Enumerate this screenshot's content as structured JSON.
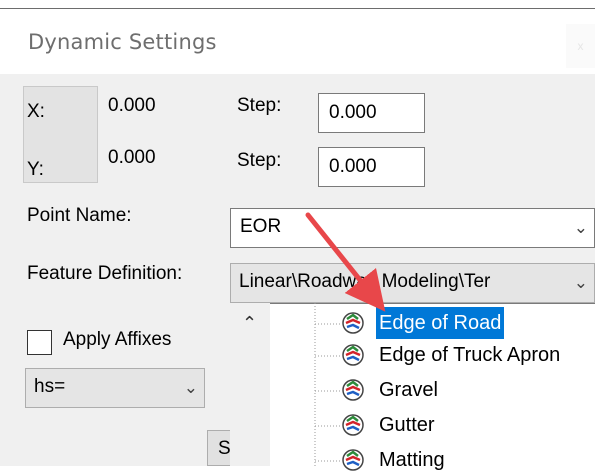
{
  "window": {
    "title": "Dynamic Settings",
    "close": "x"
  },
  "coords": {
    "x_label": "X:",
    "x_value": "0.000",
    "y_label": "Y:",
    "y_value": "0.000"
  },
  "step": {
    "label1": "Step:",
    "value1": "0.000",
    "label2": "Step:",
    "value2": "0.000"
  },
  "point_name": {
    "label": "Point Name:",
    "value": "EOR"
  },
  "feature_definition": {
    "label": "Feature Definition:",
    "value": "Linear\\Roadway Modeling\\Ter"
  },
  "affixes": {
    "label": "Apply Affixes",
    "checked": false
  },
  "prefix_select": {
    "value": "hs="
  },
  "partial_button": {
    "label": "S"
  },
  "dropdown_items": [
    {
      "label": "Edge of Road",
      "selected": true,
      "icon": "feature-icon"
    },
    {
      "label": "Edge of Truck Apron",
      "selected": false,
      "icon": "feature-icon"
    },
    {
      "label": "Gravel",
      "selected": false,
      "icon": "feature-icon"
    },
    {
      "label": "Gutter",
      "selected": false,
      "icon": "feature-icon"
    },
    {
      "label": "Matting",
      "selected": false,
      "icon": "feature-icon"
    }
  ],
  "colors": {
    "selection": "#0078d7",
    "arrow": "#e8474a",
    "panel": "#f0f0f0"
  }
}
